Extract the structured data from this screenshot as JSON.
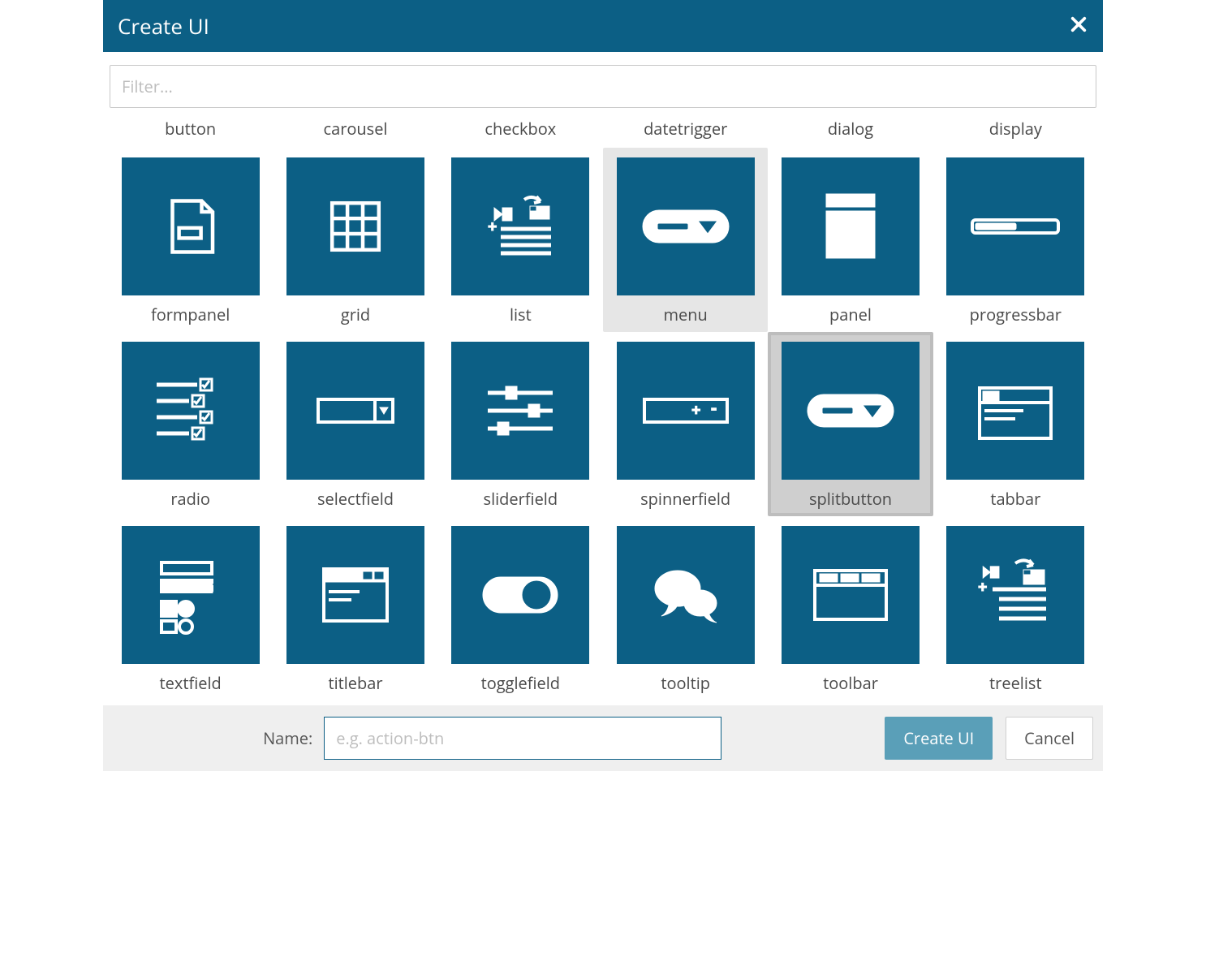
{
  "header": {
    "title": "Create UI"
  },
  "filter": {
    "placeholder": "Filter...",
    "value": ""
  },
  "top_labels": [
    "button",
    "carousel",
    "checkbox",
    "datetrigger",
    "dialog",
    "display"
  ],
  "tiles": [
    {
      "id": "formpanel",
      "label": "formpanel",
      "state": "normal"
    },
    {
      "id": "grid",
      "label": "grid",
      "state": "normal"
    },
    {
      "id": "list",
      "label": "list",
      "state": "normal"
    },
    {
      "id": "menu",
      "label": "menu",
      "state": "hover"
    },
    {
      "id": "panel",
      "label": "panel",
      "state": "normal"
    },
    {
      "id": "progressbar",
      "label": "progressbar",
      "state": "normal"
    },
    {
      "id": "radio",
      "label": "radio",
      "state": "normal"
    },
    {
      "id": "selectfield",
      "label": "selectfield",
      "state": "normal"
    },
    {
      "id": "sliderfield",
      "label": "sliderfield",
      "state": "normal"
    },
    {
      "id": "spinnerfield",
      "label": "spinnerfield",
      "state": "normal"
    },
    {
      "id": "splitbutton",
      "label": "splitbutton",
      "state": "selected"
    },
    {
      "id": "tabbar",
      "label": "tabbar",
      "state": "normal"
    },
    {
      "id": "textfield",
      "label": "textfield",
      "state": "normal"
    },
    {
      "id": "titlebar",
      "label": "titlebar",
      "state": "normal"
    },
    {
      "id": "togglefield",
      "label": "togglefield",
      "state": "normal"
    },
    {
      "id": "tooltip",
      "label": "tooltip",
      "state": "normal"
    },
    {
      "id": "toolbar",
      "label": "toolbar",
      "state": "normal"
    },
    {
      "id": "treelist",
      "label": "treelist",
      "state": "normal"
    }
  ],
  "footer": {
    "name_label": "Name:",
    "name_placeholder": "e.g. action-btn",
    "name_value": "",
    "primary": "Create UI",
    "secondary": "Cancel"
  }
}
